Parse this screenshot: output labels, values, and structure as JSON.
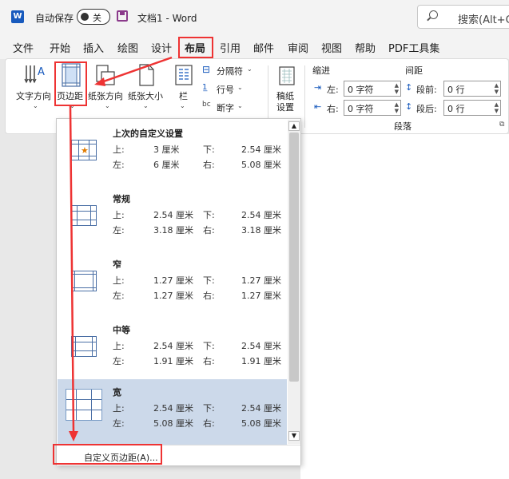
{
  "titlebar": {
    "app_icon": "W",
    "autosave_label": "自动保存",
    "toggle_state": "关",
    "doc_title": "文档1  -  Word",
    "search_placeholder": "搜索(Alt+C"
  },
  "tabs": [
    "文件",
    "开始",
    "插入",
    "绘图",
    "设计",
    "布局",
    "引用",
    "邮件",
    "审阅",
    "视图",
    "帮助",
    "PDF工具集"
  ],
  "ribbon": {
    "text_direction": "文字方向",
    "margins": "页边距",
    "orientation": "纸张方向",
    "size": "纸张大小",
    "columns": "栏",
    "breaks": "分隔符",
    "line_numbers": "行号",
    "hyphenation": "断字",
    "manuscript_line1": "稿纸",
    "manuscript_line2": "设置",
    "indent_title": "缩进",
    "spacing_title": "间距",
    "indent_left_label": "左:",
    "indent_right_label": "右:",
    "indent_left_value": "0 字符",
    "indent_right_value": "0 字符",
    "spacing_before_label": "段前:",
    "spacing_after_label": "段后:",
    "spacing_before_value": "0 行",
    "spacing_after_value": "0 行",
    "paragraph_group": "段落"
  },
  "margins_menu": {
    "presets": [
      {
        "name": "上次的自定义设置",
        "top_label": "上:",
        "top": "3 厘米",
        "bottom_label": "下:",
        "bottom": "2.54 厘米",
        "left_label": "左:",
        "left": "6 厘米",
        "right_label": "右:",
        "right": "5.08 厘米"
      },
      {
        "name": "常规",
        "top_label": "上:",
        "top": "2.54 厘米",
        "bottom_label": "下:",
        "bottom": "2.54 厘米",
        "left_label": "左:",
        "left": "3.18 厘米",
        "right_label": "右:",
        "right": "3.18 厘米"
      },
      {
        "name": "窄",
        "top_label": "上:",
        "top": "1.27 厘米",
        "bottom_label": "下:",
        "bottom": "1.27 厘米",
        "left_label": "左:",
        "left": "1.27 厘米",
        "right_label": "右:",
        "right": "1.27 厘米"
      },
      {
        "name": "中等",
        "top_label": "上:",
        "top": "2.54 厘米",
        "bottom_label": "下:",
        "bottom": "2.54 厘米",
        "left_label": "左:",
        "left": "1.91 厘米",
        "right_label": "右:",
        "right": "1.91 厘米"
      },
      {
        "name": "宽",
        "top_label": "上:",
        "top": "2.54 厘米",
        "bottom_label": "下:",
        "bottom": "2.54 厘米",
        "left_label": "左:",
        "left": "5.08 厘米",
        "right_label": "右:",
        "right": "5.08 厘米"
      }
    ],
    "custom_label": "自定义页边距(A)..."
  },
  "colors": {
    "annotation": "#e33333",
    "selected_preset": "#ccd9ea",
    "word_blue": "#185abd"
  }
}
